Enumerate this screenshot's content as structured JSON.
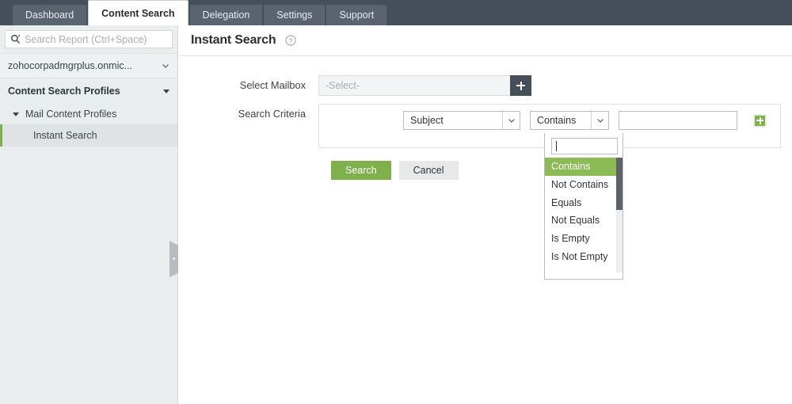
{
  "topbar": {
    "tabs": [
      {
        "label": "Dashboard",
        "active": false
      },
      {
        "label": "Content Search",
        "active": true
      },
      {
        "label": "Delegation",
        "active": false
      },
      {
        "label": "Settings",
        "active": false
      },
      {
        "label": "Support",
        "active": false
      }
    ],
    "bg_color": "#454f59",
    "tab_bg_color": "#5a646e"
  },
  "sidebar": {
    "search": {
      "placeholder": "Search Report (Ctrl+Space)",
      "value": "",
      "icon": "search-icon"
    },
    "tenant": {
      "label": "zohocorpadmgrplus.onmic...",
      "icon": "chevron-down-icon"
    },
    "section": {
      "title": "Content Search Profiles",
      "icon": "triangle-down-icon"
    },
    "group": {
      "label": "Mail Content Profiles",
      "icon": "triangle-down-icon"
    },
    "leaf": {
      "label": "Instant Search",
      "selected": true,
      "accent_color": "#7fb14b"
    },
    "bg_color": "#e9edee",
    "collapse_handle": "collapse-sidebar-handle"
  },
  "page": {
    "title": "Instant Search",
    "help_icon": "help-circle-icon"
  },
  "form": {
    "mailbox": {
      "label": "Select Mailbox",
      "placeholder": "-Select-",
      "value": "",
      "add_icon": "plus-icon"
    },
    "criteria": {
      "label": "Search Criteria",
      "field_select": {
        "value": "Subject",
        "icon": "chevron-down-icon"
      },
      "operator_select": {
        "value": "Contains",
        "icon": "chevron-down-icon",
        "open": true
      },
      "value_input": {
        "value": "",
        "placeholder": ""
      },
      "add_row_icon": "plus-icon",
      "add_row_color": "#7fb14b"
    },
    "buttons": {
      "search": "Search",
      "cancel": "Cancel",
      "search_color": "#7fb14b",
      "cancel_color": "#e6e8ea"
    }
  },
  "dropdown": {
    "search_value": "",
    "selected": "Contains",
    "highlight_color": "#8cba54",
    "options": [
      "Contains",
      "Not Contains",
      "Equals",
      "Not Equals",
      "Is Empty",
      "Is Not Empty"
    ]
  }
}
